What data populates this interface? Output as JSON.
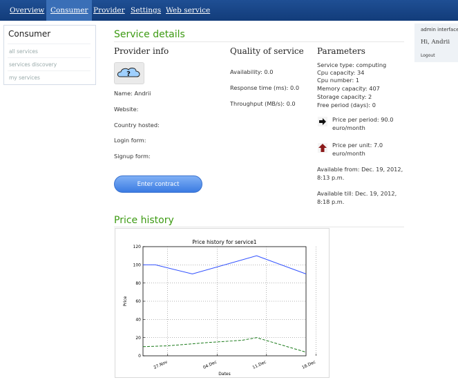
{
  "nav": {
    "items": [
      {
        "label": "Overview",
        "active": false
      },
      {
        "label": "Consumer",
        "active": true
      },
      {
        "label": "Provider",
        "active": false
      },
      {
        "label": "Settings",
        "active": false
      },
      {
        "label": "Web service",
        "active": false
      }
    ]
  },
  "sidebar": {
    "title": "Consumer",
    "links": [
      "all services",
      "services discovery",
      "my services"
    ]
  },
  "user_panel": {
    "admin_link": "admin interface",
    "greeting": "Hi, Andrii",
    "logout": "Logout"
  },
  "service_details": {
    "heading": "Service details",
    "provider_info": {
      "heading": "Provider info",
      "logo_icon": "question-cloud-icon",
      "name": "Name: Andrii",
      "website": "Website:",
      "country": "Country hosted:",
      "login_form": "Login form:",
      "signup_form": "Signup form:"
    },
    "quality": {
      "heading": "Quality of service",
      "availability": "Availability: 0.0",
      "response_time": "Response time (ms): 0.0",
      "throughput": "Throughput (MB/s): 0.0"
    },
    "parameters": {
      "heading": "Parameters",
      "lines": [
        "Service type: computing",
        "Cpu capacity: 34",
        "Cpu number: 1",
        "Memory capacity: 407",
        "Storage capacity: 2",
        "Free period (days): 0"
      ],
      "price_per_period": "Price per period: 90.0 euro/month",
      "price_per_period_icon": "right-arrow-icon",
      "price_per_unit": "Price per unit: 7.0 euro/month",
      "price_per_unit_icon": "up-arrow-icon",
      "available_from": "Available from: Dec. 19, 2012, 8:13 p.m.",
      "available_till": "Available till: Dec. 19, 2012, 8:18 p.m."
    },
    "enter_contract": "Enter contract"
  },
  "price_history": {
    "heading": "Price history"
  },
  "chart_data": {
    "type": "line",
    "title": "Price history for service1",
    "xlabel": "Dates",
    "ylabel": "Price",
    "ylim": [
      0,
      120
    ],
    "yticks": [
      0,
      20,
      40,
      60,
      80,
      100,
      120
    ],
    "xtick_labels": [
      "27.Nov",
      "04.Dec",
      "11.Dec",
      "18.Dec"
    ],
    "grid": true,
    "series": [
      {
        "color": "#2f4fff",
        "style": "solid",
        "points": [
          [
            0,
            100
          ],
          [
            0.25,
            100
          ],
          [
            1,
            90
          ],
          [
            2.3,
            110
          ],
          [
            3.3,
            90
          ]
        ]
      },
      {
        "color": "#1a7a1a",
        "style": "dashed",
        "points": [
          [
            0,
            10
          ],
          [
            0.5,
            11
          ],
          [
            1.4,
            15
          ],
          [
            2,
            17
          ],
          [
            2.3,
            20
          ],
          [
            3.3,
            4
          ]
        ]
      }
    ]
  }
}
